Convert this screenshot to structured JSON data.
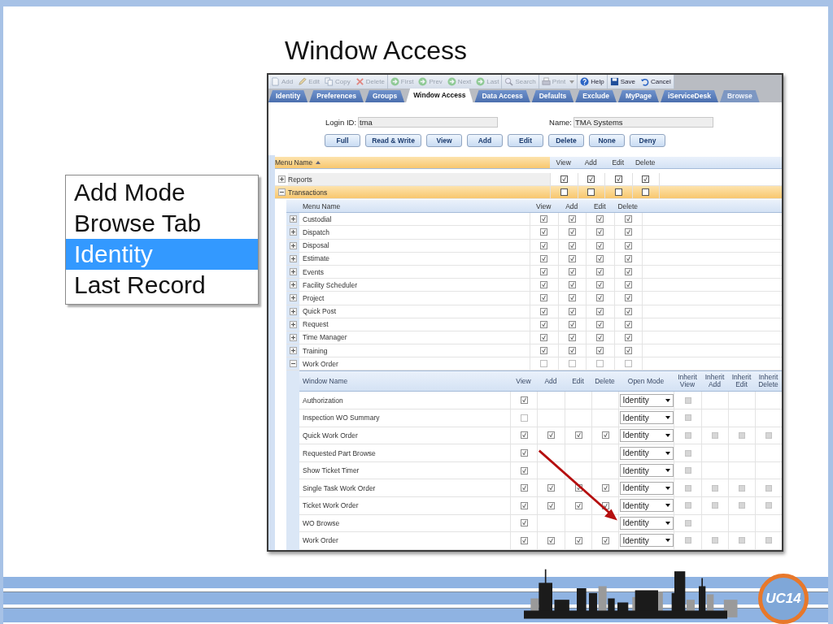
{
  "title": "Window Access",
  "callout": {
    "items": [
      {
        "label": "Add Mode",
        "selected": false
      },
      {
        "label": "Browse Tab",
        "selected": false
      },
      {
        "label": "Identity",
        "selected": true
      },
      {
        "label": "Last Record",
        "selected": false
      }
    ]
  },
  "toolbar": [
    [
      {
        "label": "Add",
        "disabled": true,
        "has_menu": false
      },
      {
        "label": "Edit",
        "disabled": true,
        "has_menu": false
      },
      {
        "label": "Copy",
        "disabled": true,
        "has_menu": false
      },
      {
        "label": "Delete",
        "disabled": true,
        "has_menu": false
      }
    ],
    [
      {
        "label": "First",
        "disabled": true,
        "has_menu": false
      },
      {
        "label": "Prev",
        "disabled": true,
        "has_menu": false
      },
      {
        "label": "Next",
        "disabled": true,
        "has_menu": false
      },
      {
        "label": "Last",
        "disabled": true,
        "has_menu": false
      }
    ],
    [
      {
        "label": "Search",
        "disabled": true,
        "has_menu": false
      }
    ],
    [
      {
        "label": "Print",
        "disabled": true,
        "has_menu": true
      }
    ],
    [
      {
        "label": "Help",
        "disabled": false,
        "has_menu": false
      }
    ],
    [
      {
        "label": "Save",
        "disabled": false,
        "has_menu": false
      },
      {
        "label": "Cancel",
        "disabled": false,
        "has_menu": false
      }
    ]
  ],
  "tabs": [
    {
      "label": "Identity",
      "selected": false,
      "disabled": false
    },
    {
      "label": "Preferences",
      "selected": false,
      "disabled": false
    },
    {
      "label": "Groups",
      "selected": false,
      "disabled": false
    },
    {
      "label": "Window Access",
      "selected": true,
      "disabled": false
    },
    {
      "label": "Data Access",
      "selected": false,
      "disabled": false
    },
    {
      "label": "Defaults",
      "selected": false,
      "disabled": false
    },
    {
      "label": "Exclude",
      "selected": false,
      "disabled": false
    },
    {
      "label": "MyPage",
      "selected": false,
      "disabled": false
    },
    {
      "label": "iServiceDesk",
      "selected": false,
      "disabled": false
    },
    {
      "label": "Browse",
      "selected": false,
      "disabled": true
    }
  ],
  "login": {
    "label": "Login ID:",
    "value": "tma"
  },
  "name_field": {
    "label": "Name:",
    "value": "TMA Systems"
  },
  "buttons": [
    "Full",
    "Read & Write",
    "View",
    "Add",
    "Edit",
    "Delete",
    "None",
    "Deny"
  ],
  "menu_grid": {
    "columns": [
      {
        "label": "Menu Name",
        "sorted": true
      },
      {
        "label": "View",
        "sorted": false
      },
      {
        "label": "Add",
        "sorted": false
      },
      {
        "label": "Edit",
        "sorted": false
      },
      {
        "label": "Delete",
        "sorted": false
      }
    ],
    "rows": [
      {
        "name": "Reports",
        "expanded": false,
        "selected": false,
        "view": true,
        "add": true,
        "edit": true,
        "delete": true
      },
      {
        "name": "Transactions",
        "expanded": true,
        "selected": true,
        "view": false,
        "add": false,
        "edit": false,
        "delete": false
      }
    ]
  },
  "submenu_grid": {
    "columns": [
      "Menu Name",
      "View",
      "Add",
      "Edit",
      "Delete"
    ],
    "rows": [
      {
        "name": "Custodial",
        "expanded": false,
        "view": true,
        "add": true,
        "edit": true,
        "delete": true
      },
      {
        "name": "Dispatch",
        "expanded": false,
        "view": true,
        "add": true,
        "edit": true,
        "delete": true
      },
      {
        "name": "Disposal",
        "expanded": false,
        "view": true,
        "add": true,
        "edit": true,
        "delete": true
      },
      {
        "name": "Estimate",
        "expanded": false,
        "view": true,
        "add": true,
        "edit": true,
        "delete": true
      },
      {
        "name": "Events",
        "expanded": false,
        "view": true,
        "add": true,
        "edit": true,
        "delete": true
      },
      {
        "name": "Facility Scheduler",
        "expanded": false,
        "view": true,
        "add": true,
        "edit": true,
        "delete": true
      },
      {
        "name": "Project",
        "expanded": false,
        "view": true,
        "add": true,
        "edit": true,
        "delete": true
      },
      {
        "name": "Quick Post",
        "expanded": false,
        "view": true,
        "add": true,
        "edit": true,
        "delete": true
      },
      {
        "name": "Request",
        "expanded": false,
        "view": true,
        "add": true,
        "edit": true,
        "delete": true
      },
      {
        "name": "Time Manager",
        "expanded": false,
        "view": true,
        "add": true,
        "edit": true,
        "delete": true
      },
      {
        "name": "Training",
        "expanded": false,
        "view": true,
        "add": true,
        "edit": true,
        "delete": true
      },
      {
        "name": "Work Order",
        "expanded": true,
        "view": false,
        "add": false,
        "edit": false,
        "delete": false
      }
    ]
  },
  "window_grid": {
    "columns": [
      "Window Name",
      "View",
      "Add",
      "Edit",
      "Delete",
      "Open Mode",
      "Inherit View",
      "Inherit Add",
      "Inherit Edit",
      "Inherit Delete"
    ],
    "rows": [
      {
        "name": "Authorization",
        "kind": "view_only",
        "view": true,
        "open_mode": "Identity"
      },
      {
        "name": "Inspection WO Summary",
        "kind": "view_only",
        "view": false,
        "open_mode": "Identity"
      },
      {
        "name": "Quick Work Order",
        "kind": "full",
        "view": true,
        "add": true,
        "edit": true,
        "delete": true,
        "open_mode": "Identity"
      },
      {
        "name": "Requested Part Browse",
        "kind": "view_only",
        "view": true,
        "open_mode": "Identity"
      },
      {
        "name": "Show Ticket Timer",
        "kind": "view_only",
        "view": true,
        "open_mode": "Identity"
      },
      {
        "name": "Single Task Work Order",
        "kind": "full",
        "view": true,
        "add": true,
        "edit": true,
        "delete": true,
        "open_mode": "Identity"
      },
      {
        "name": "Ticket Work Order",
        "kind": "full",
        "view": true,
        "add": true,
        "edit": true,
        "delete": true,
        "open_mode": "Identity"
      },
      {
        "name": "WO Browse",
        "kind": "view_only",
        "view": true,
        "open_mode": "Identity"
      },
      {
        "name": "Work Order",
        "kind": "full",
        "view": true,
        "add": true,
        "edit": true,
        "delete": true,
        "open_mode": "Identity"
      }
    ]
  },
  "footer": {
    "logo_text": "UC14"
  }
}
